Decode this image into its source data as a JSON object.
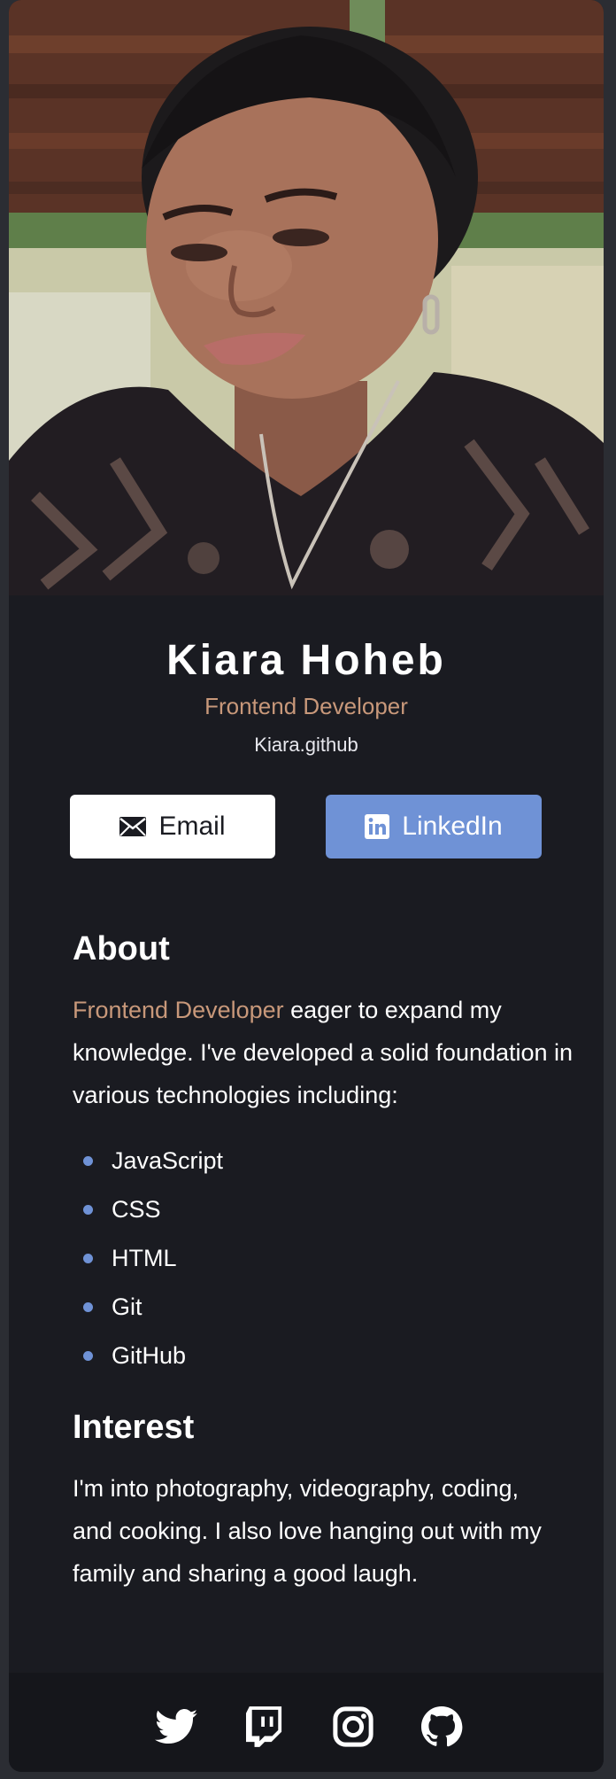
{
  "profile": {
    "name": "Kiara Hoheb",
    "role": "Frontend Developer",
    "website": "Kiara.github"
  },
  "buttons": {
    "email_label": "Email",
    "linkedin_label": "LinkedIn"
  },
  "about": {
    "heading": "About",
    "highlight": "Frontend Developer",
    "text": " eager to expand my knowledge. I've developed a solid foundation in various technologies including:",
    "skills": [
      "JavaScript",
      "CSS",
      "HTML",
      "Git",
      "GitHub"
    ]
  },
  "interest": {
    "heading": "Interest",
    "text": "I'm into photography, videography, coding, and cooking. I also love hanging out with my family and sharing a good laugh."
  },
  "footer": {
    "icons": [
      "twitter-icon",
      "twitch-icon",
      "instagram-icon",
      "github-icon"
    ]
  },
  "colors": {
    "background": "#1a1b21",
    "accent": "#c8987a",
    "button_blue": "#6f92d6",
    "footer": "#15161b"
  }
}
